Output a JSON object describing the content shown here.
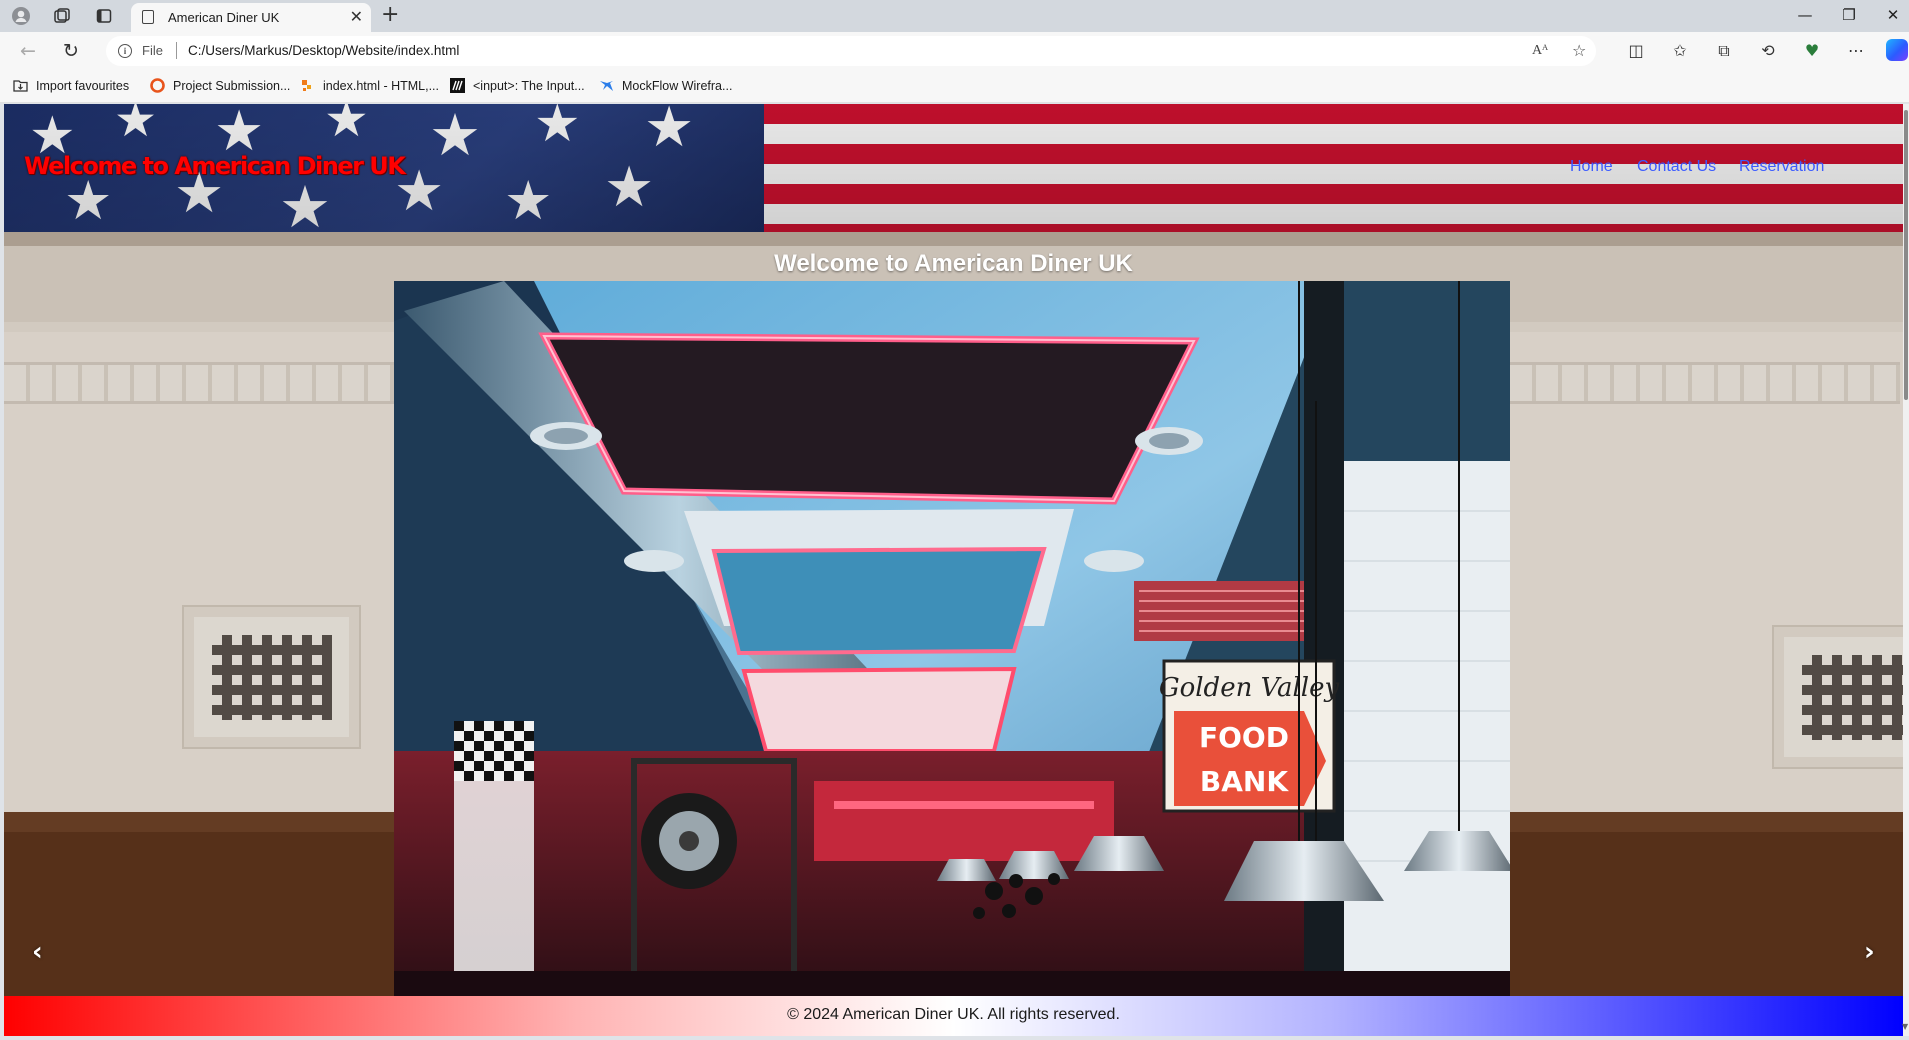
{
  "browser": {
    "tab_title": "American Diner UK",
    "url_scheme": "File",
    "url": "C:/Users/Markus/Desktop/Website/index.html",
    "favourites": [
      {
        "label": "Import favourites",
        "icon": "import-folder-icon"
      },
      {
        "label": "Project Submission...",
        "icon": "orange-ring-icon"
      },
      {
        "label": "index.html - HTML,...",
        "icon": "orange-code-icon"
      },
      {
        "label": "<input>: The Input...",
        "icon": "mdn-icon"
      },
      {
        "label": "MockFlow Wirefra...",
        "icon": "mockflow-icon"
      }
    ]
  },
  "site": {
    "header_title": "Welcome to American Diner UK",
    "nav": {
      "home": "Home",
      "contact": "Contact Us",
      "reservation": "Reservation"
    },
    "hero_heading": "Welcome to American Diner UK",
    "sign": {
      "line1": "Golden Valley",
      "line2": "FOOD",
      "line3": "BANK"
    },
    "carousel": {
      "prev": "‹",
      "next": "›"
    },
    "footer": "© 2024 American Diner UK. All rights reserved."
  },
  "colors": {
    "title_red": "#ff0000",
    "nav_blue": "#3b5bff",
    "footer_gradient": [
      "#ff0000",
      "#ffffff",
      "#0000ff"
    ]
  }
}
